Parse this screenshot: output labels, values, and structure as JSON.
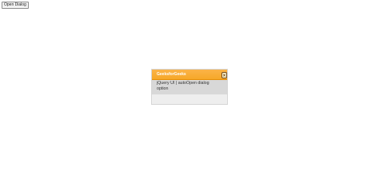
{
  "page": {
    "open_button_label": "Open Dialog"
  },
  "dialog": {
    "title": "GeeksforGeeks",
    "message": "jQuery UI | autoOpen dialog option",
    "close_icon": "close-icon",
    "colors": {
      "titlebar": "#f6a828",
      "titlebar_border": "#e78f08",
      "close_button": "#fdf5ce",
      "content": "#d8d8d8",
      "dialog_bg": "#f0f0f0"
    }
  }
}
